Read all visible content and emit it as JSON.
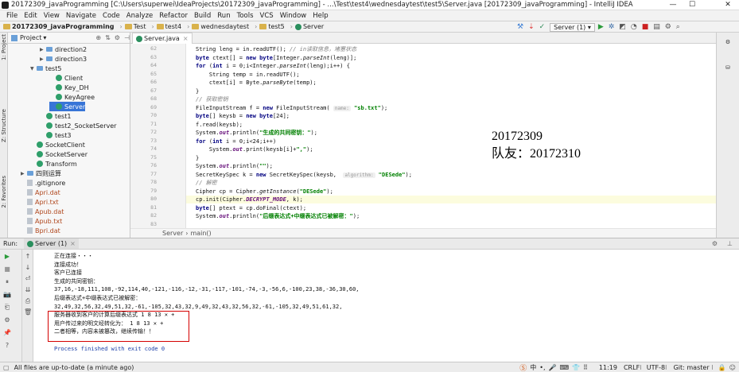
{
  "window": {
    "title": "20172309_javaProgramming [C:\\Users\\superwei\\IdeaProjects\\20172309_javaProgramming] - ...\\Test\\test4\\wednesdaytest\\test5\\Server.java [20172309_javaProgramming] - IntelliJ IDEA",
    "controls": [
      "—",
      "☐",
      "✕"
    ]
  },
  "menu": [
    "File",
    "Edit",
    "View",
    "Navigate",
    "Code",
    "Analyze",
    "Refactor",
    "Build",
    "Run",
    "Tools",
    "VCS",
    "Window",
    "Help"
  ],
  "breadcrumbs": [
    "20172309_javaProgramming",
    "Test",
    "test4",
    "wednesdaytest",
    "test5",
    "Server"
  ],
  "toolbar": {
    "run_config": "Server (1)"
  },
  "project_panel": {
    "header": "Project",
    "side_labels": [
      "1: Project",
      "Z: Structure",
      "2: Favorites"
    ],
    "tree": [
      {
        "label": "direction2",
        "indent": 5,
        "type": "folder-blue",
        "arrow": "▶"
      },
      {
        "label": "direction3",
        "indent": 5,
        "type": "folder-blue",
        "arrow": "▶"
      },
      {
        "label": "test5",
        "indent": 4,
        "type": "folder-blue",
        "arrow": "▼"
      },
      {
        "label": "Client",
        "indent": 6,
        "type": "class",
        "arrow": ""
      },
      {
        "label": "Key_DH",
        "indent": 6,
        "type": "class",
        "arrow": ""
      },
      {
        "label": "KeyAgree",
        "indent": 6,
        "type": "class",
        "arrow": ""
      },
      {
        "label": "Server",
        "indent": 6,
        "type": "class",
        "arrow": "",
        "selected": true
      },
      {
        "label": "test1",
        "indent": 5,
        "type": "class",
        "arrow": ""
      },
      {
        "label": "test2_SocketServer",
        "indent": 5,
        "type": "class",
        "arrow": ""
      },
      {
        "label": "test3",
        "indent": 5,
        "type": "class",
        "arrow": ""
      },
      {
        "label": "SocketClient",
        "indent": 4,
        "type": "class",
        "arrow": ""
      },
      {
        "label": "SocketServer",
        "indent": 4,
        "type": "class",
        "arrow": ""
      },
      {
        "label": "Transform",
        "indent": 4,
        "type": "class",
        "arrow": ""
      },
      {
        "label": "四则运算",
        "indent": 3,
        "type": "folder-blue",
        "arrow": "▶"
      },
      {
        "label": ".gitignore",
        "indent": 3,
        "type": "file",
        "arrow": ""
      },
      {
        "label": "Apri.dat",
        "indent": 3,
        "type": "file",
        "arrow": ""
      },
      {
        "label": "Apri.txt",
        "indent": 3,
        "type": "file",
        "arrow": ""
      },
      {
        "label": "Apub.dat",
        "indent": 3,
        "type": "file",
        "arrow": ""
      },
      {
        "label": "Apub.txt",
        "indent": 3,
        "type": "file",
        "arrow": ""
      },
      {
        "label": "Bpri.dat",
        "indent": 3,
        "type": "file",
        "arrow": ""
      }
    ]
  },
  "editor": {
    "tab": "Server.java",
    "line_numbers": [
      "62",
      "63",
      "64",
      "65",
      "66",
      "67",
      "68",
      "69",
      "70",
      "71",
      "72",
      "73",
      "74",
      "75",
      "76",
      "77",
      "78",
      "79",
      "80",
      "81",
      "82",
      "83"
    ],
    "breadcrumb": [
      "Server",
      "main()"
    ],
    "overlay": [
      "20172309",
      "队友：20172310"
    ],
    "code": [
      {
        "tokens": [
          [
            "",
            "String leng = in.readUTF(); "
          ],
          [
            "cmt",
            "// in读取信息，堵塞状态"
          ]
        ]
      },
      {
        "tokens": [
          [
            "kw",
            "byte"
          ],
          [
            "",
            " ctext[] = "
          ],
          [
            "kw",
            "new byte"
          ],
          [
            "",
            "[Integer."
          ],
          [
            "sm",
            "parseInt"
          ],
          [
            "",
            "(leng)];"
          ]
        ]
      },
      {
        "tokens": [
          [
            "kw",
            "for"
          ],
          [
            "",
            " ("
          ],
          [
            "kw",
            "int"
          ],
          [
            "",
            " i = 0;i<Integer."
          ],
          [
            "sm",
            "parseInt"
          ],
          [
            "",
            "(leng);i++) {"
          ]
        ]
      },
      {
        "tokens": [
          [
            "",
            "    String temp = in.readUTF();"
          ]
        ]
      },
      {
        "tokens": [
          [
            "",
            "    ctext[i] = Byte."
          ],
          [
            "sm",
            "parseByte"
          ],
          [
            "",
            "(temp);"
          ]
        ]
      },
      {
        "tokens": [
          [
            "",
            "}"
          ]
        ]
      },
      {
        "tokens": [
          [
            "cmt",
            "// 获取密钥"
          ]
        ]
      },
      {
        "tokens": [
          [
            "",
            "FileInputStream f = "
          ],
          [
            "kw",
            "new"
          ],
          [
            "",
            " FileInputStream( "
          ],
          [
            "hint",
            "name:"
          ],
          [
            "",
            " "
          ],
          [
            "str",
            "\"sb.txt\""
          ],
          [
            "",
            ");"
          ]
        ]
      },
      {
        "tokens": [
          [
            "kw",
            "byte"
          ],
          [
            "",
            "[] keysb = "
          ],
          [
            "kw",
            "new byte"
          ],
          [
            "",
            "[24];"
          ]
        ]
      },
      {
        "tokens": [
          [
            "",
            "f.read(keysb);"
          ]
        ]
      },
      {
        "tokens": [
          [
            "",
            "System."
          ],
          [
            "sfield",
            "out"
          ],
          [
            "",
            ".println("
          ],
          [
            "str",
            "\"生成的共同密钥：\""
          ],
          [
            "",
            ");"
          ]
        ]
      },
      {
        "tokens": [
          [
            "kw",
            "for"
          ],
          [
            "",
            " ("
          ],
          [
            "kw",
            "int"
          ],
          [
            "",
            " i = 0;i<24;i++)"
          ]
        ]
      },
      {
        "tokens": [
          [
            "",
            "    System."
          ],
          [
            "sfield",
            "out"
          ],
          [
            "",
            ".print(keysb[i]+"
          ],
          [
            "str",
            "\",\""
          ],
          [
            "",
            ");"
          ]
        ]
      },
      {
        "tokens": [
          [
            "",
            "}"
          ]
        ]
      },
      {
        "tokens": [
          [
            "",
            "System."
          ],
          [
            "sfield",
            "out"
          ],
          [
            "",
            ".println("
          ],
          [
            "str",
            "\"\""
          ],
          [
            "",
            ");"
          ]
        ]
      },
      {
        "tokens": [
          [
            "",
            "SecretKeySpec k = "
          ],
          [
            "kw",
            "new"
          ],
          [
            "",
            " SecretKeySpec(keysb,  "
          ],
          [
            "hint",
            "algorithm:"
          ],
          [
            "",
            " "
          ],
          [
            "str",
            "\"DESede\""
          ],
          [
            "",
            ");"
          ]
        ]
      },
      {
        "tokens": [
          [
            "cmt",
            "// 解密"
          ]
        ]
      },
      {
        "tokens": [
          [
            "",
            "Cipher cp = Cipher."
          ],
          [
            "sm",
            "getInstance"
          ],
          [
            "",
            "("
          ],
          [
            "str",
            "\"DESede\""
          ],
          [
            "",
            ");"
          ]
        ]
      },
      {
        "tokens": [
          [
            "",
            "cp.init(Cipher."
          ],
          [
            "sfield",
            "DECRYPT_MODE"
          ],
          [
            "",
            ", k);"
          ]
        ],
        "highlight": true
      },
      {
        "tokens": [
          [
            "kw",
            "byte"
          ],
          [
            "",
            "[] ptext = cp.doFinal(ctext);"
          ]
        ]
      },
      {
        "tokens": [
          [
            "",
            "System."
          ],
          [
            "sfield",
            "out"
          ],
          [
            "",
            ".println("
          ],
          [
            "str",
            "\"后缀表达式+中缀表达式已被解密：\""
          ],
          [
            "",
            ");"
          ]
        ]
      },
      {
        "tokens": [
          [
            "",
            ""
          ]
        ]
      }
    ]
  },
  "run_panel": {
    "label": "Run:",
    "tab": "Server (1)",
    "output": [
      {
        "text": "正在连接・・・",
        "style": ""
      },
      {
        "text": "连接成功！",
        "style": ""
      },
      {
        "text": "客户已连接",
        "style": ""
      },
      {
        "text": "生成的共同密钥：",
        "style": ""
      },
      {
        "text": "37,16,-18,111,108,-92,114,40,-121,-116,-12,-31,-117,-101,-74,-3,-56,6,-100,23,38,-36,30,60,",
        "style": ""
      },
      {
        "text": "后缀表达式+中缀表达式已被解密：",
        "style": ""
      },
      {
        "text": "32,49,32,56,32,49,51,32,-61,-105,32,43,32,9,49,32,43,32,56,32,-61,-105,32,49,51,61,32,",
        "style": ""
      },
      {
        "text": "服务器收到客户的计算后缀表达式 1 8 13 ✕ +",
        "style": ""
      },
      {
        "text": "用户传过来的明文经转化为： 1 8 13 ✕ +",
        "style": ""
      },
      {
        "text": "二者相等，内容未被篡改，继续传输！！",
        "style": ""
      },
      {
        "text": "",
        "style": ""
      },
      {
        "text": "Process finished with exit code 0",
        "style": "blue"
      }
    ]
  },
  "status_bar": {
    "message": "All files are up-to-date (a minute ago)",
    "right": [
      "11:19",
      "CRLF⁝",
      "UTF-8⁝",
      "Git: master ⁝"
    ]
  }
}
